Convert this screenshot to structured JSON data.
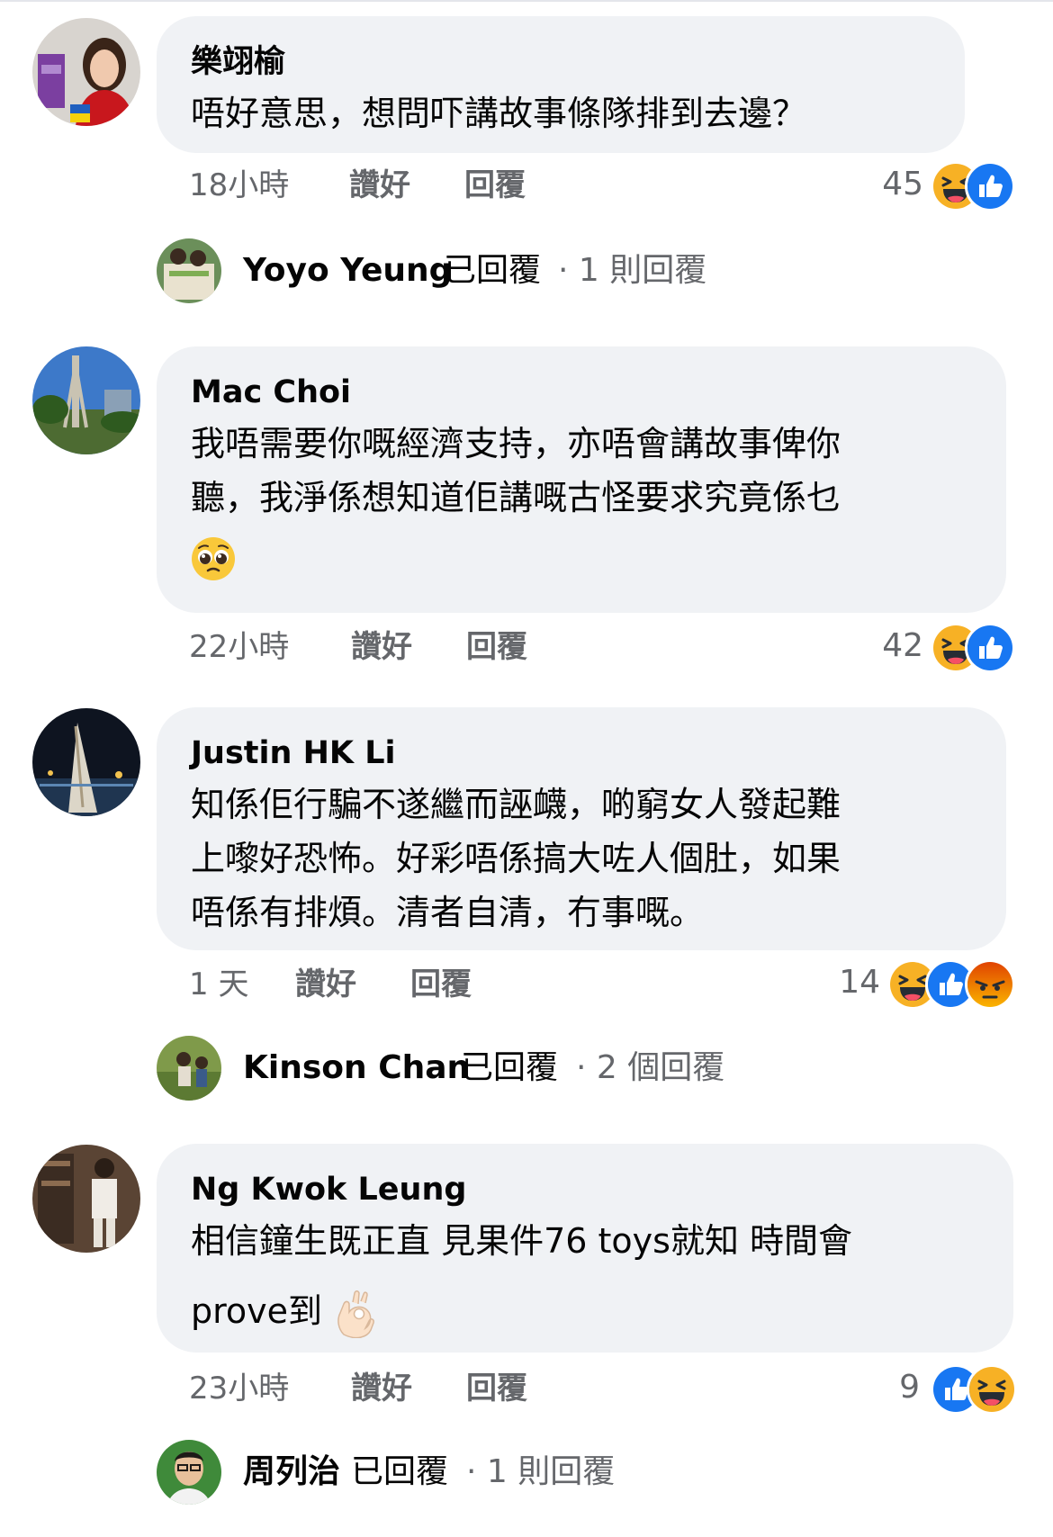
{
  "comments": [
    {
      "author": "樂翊榆",
      "lines": [
        "唔好意思，想問吓講故事條隊排到去邊？"
      ],
      "time": "18小時",
      "like": "讚好",
      "reply": "回覆",
      "reaction_count": "45",
      "reactions": [
        "haha-icon",
        "like-icon"
      ],
      "replies": {
        "name": "Yoyo Yeung",
        "suffix": "已回覆",
        "count": "· 1 則回覆"
      }
    },
    {
      "author": "Mac Choi",
      "lines": [
        "我唔需要你嘅經濟支持，亦唔會講故事俾你",
        "聽，我淨係想知道佢講嘅古怪要求究竟係乜"
      ],
      "emoji": "pleading-face-emoji",
      "time": "22小時",
      "like": "讚好",
      "reply": "回覆",
      "reaction_count": "42",
      "reactions": [
        "haha-icon",
        "like-icon"
      ]
    },
    {
      "author": "Justin HK Li",
      "lines": [
        "知係佢行騙不遂繼而誣衊，啲窮女人發起難",
        "上嚟好恐怖。好彩唔係搞大咗人個肚，如果",
        "唔係有排煩。清者自清，冇事嘅。"
      ],
      "time": "1 天",
      "like": "讚好",
      "reply": "回覆",
      "reaction_count": "14",
      "reactions": [
        "haha-icon",
        "like-icon",
        "angry-icon"
      ],
      "replies": {
        "name": "Kinson Chan",
        "suffix": "已回覆",
        "count": "· 2 個回覆"
      }
    },
    {
      "author": "Ng Kwok Leung",
      "lines": [
        "相信鐘生既正直 見果件76 toys就知 時間會"
      ],
      "last_line": "prove到",
      "emoji": "ok-hand-emoji",
      "time": "23小時",
      "like": "讚好",
      "reply": "回覆",
      "reaction_count": "9",
      "reactions": [
        "like-icon",
        "haha-icon"
      ],
      "replies": {
        "name": "周列治",
        "suffix": "已回覆",
        "count": "· 1 則回覆"
      }
    }
  ],
  "colors": {
    "bubble": "#f0f2f5",
    "meta_text": "#65676b",
    "like_blue": "#1877f2",
    "haha_yellow": "#f7b125",
    "angry_orange": "#e9710f"
  }
}
